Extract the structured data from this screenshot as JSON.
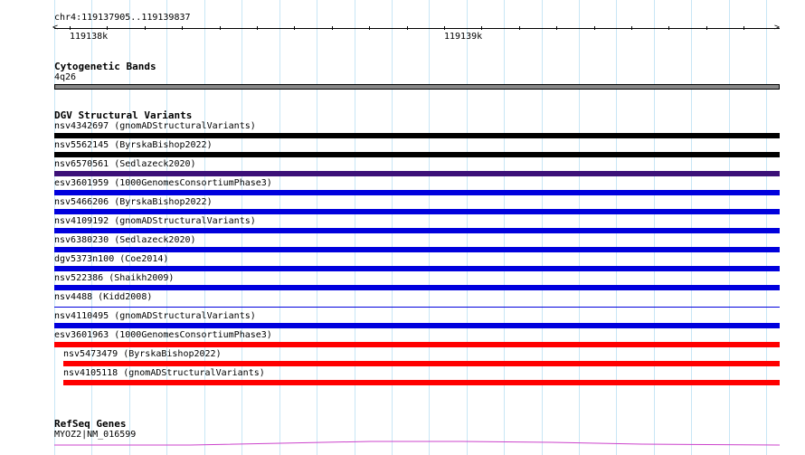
{
  "ruler": {
    "region": "chr4:119137905..119139837",
    "ticks": [
      {
        "label": "119138k",
        "position": 119138000
      },
      {
        "label": "119139k",
        "position": 119139000
      }
    ],
    "start": 119137905,
    "end": 119139837
  },
  "cytoband": {
    "title": "Cytogenetic Bands",
    "band_label": "4q26",
    "color": "#888888"
  },
  "dgv": {
    "title": "DGV Structural Variants",
    "variants": [
      {
        "label": "nsv4342697 (gnomADStructuralVariants)",
        "color": "#000000",
        "style": "thick"
      },
      {
        "label": "nsv5562145 (ByrskaBishop2022)",
        "color": "#000000",
        "style": "thick"
      },
      {
        "label": "nsv6570561 (Sedlazeck2020)",
        "color": "#3c1078",
        "style": "thick"
      },
      {
        "label": "esv3601959 (1000GenomesConsortiumPhase3)",
        "color": "#0000dd",
        "style": "thick"
      },
      {
        "label": "nsv5466206 (ByrskaBishop2022)",
        "color": "#0000dd",
        "style": "thick"
      },
      {
        "label": "nsv4109192 (gnomADStructuralVariants)",
        "color": "#0000dd",
        "style": "thick"
      },
      {
        "label": "nsv6380230 (Sedlazeck2020)",
        "color": "#0000dd",
        "style": "thick"
      },
      {
        "label": "dgv5373n100 (Coe2014)",
        "color": "#0000dd",
        "style": "thick"
      },
      {
        "label": "nsv522386 (Shaikh2009)",
        "color": "#0000dd",
        "style": "thick"
      },
      {
        "label": "nsv4488 (Kidd2008)",
        "color": "#0000dd",
        "style": "thin"
      },
      {
        "label": "nsv4110495 (gnomADStructuralVariants)",
        "color": "#0000dd",
        "style": "thick"
      },
      {
        "label": "esv3601963 (1000GenomesConsortiumPhase3)",
        "color": "#ff0000",
        "style": "thick"
      },
      {
        "label": "nsv5473479 (ByrskaBishop2022)",
        "color": "#ff0000",
        "style": "thick",
        "indent": true
      },
      {
        "label": "nsv4105118 (gnomADStructuralVariants)",
        "color": "#ff0000",
        "style": "thick",
        "indent": true
      }
    ]
  },
  "refseq": {
    "title": "RefSeq Genes",
    "gene_label": "MYOZ2|NM_016599",
    "color": "#cc44cc"
  }
}
